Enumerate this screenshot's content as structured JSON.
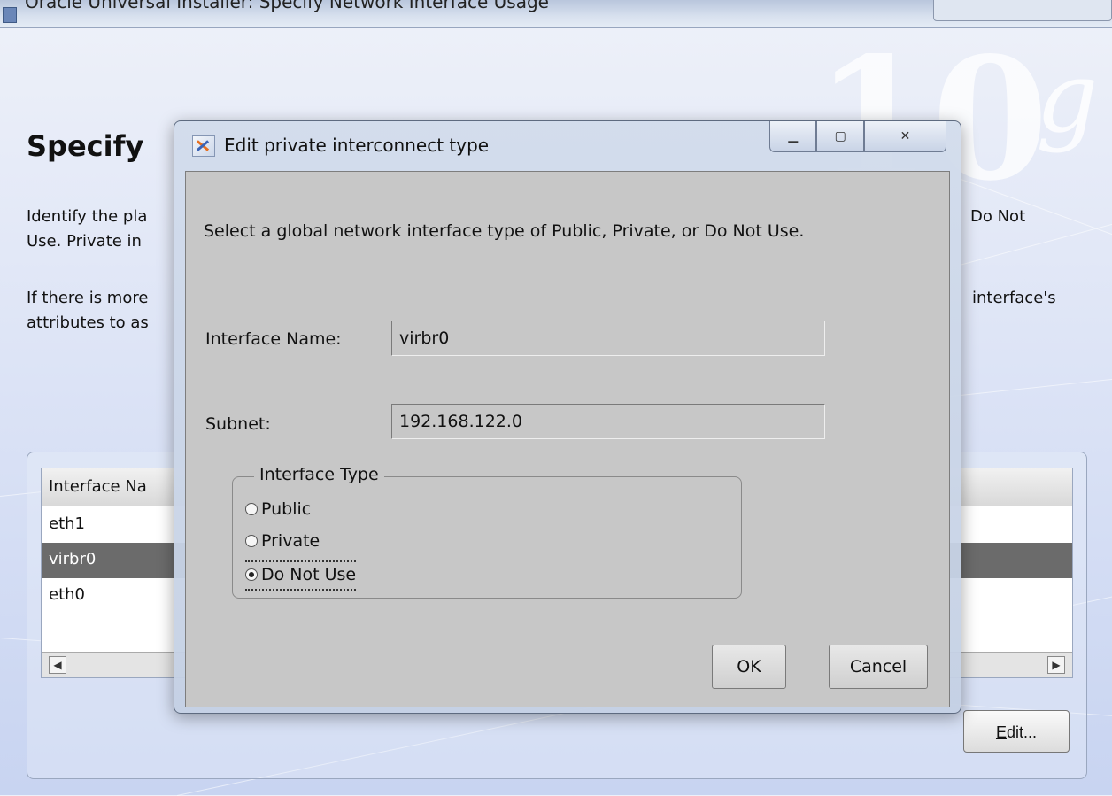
{
  "background_window": {
    "title": "Oracle Universal Installer: Specify Network Interface Usage",
    "heading": "Specify",
    "deco_number": "10",
    "deco_letter": "g",
    "para1_line1_left": "Identify the pla",
    "para1_line1_right": "Do Not",
    "para1_line2_left": "Use.  Private in",
    "para2_line1_left": "If there is more",
    "para2_line1_right": "interface's",
    "para2_line2_left": "attributes to as",
    "table": {
      "header": "Interface Na",
      "rows": [
        "eth1",
        "virbr0",
        "eth0"
      ],
      "selected_index": 1
    },
    "edit_button": {
      "underlined": "E",
      "rest": "dit..."
    }
  },
  "dialog": {
    "title": "Edit private interconnect type",
    "message": "Select a global network interface type of Public, Private, or Do Not Use.",
    "interface_name_label": "Interface Name:",
    "interface_name_value": "virbr0",
    "subnet_label": "Subnet:",
    "subnet_value": "192.168.122.0",
    "interface_type": {
      "legend": "Interface Type",
      "options": [
        "Public",
        "Private",
        "Do Not Use"
      ],
      "selected": "Do Not Use"
    },
    "ok_label": "OK",
    "cancel_label": "Cancel"
  }
}
